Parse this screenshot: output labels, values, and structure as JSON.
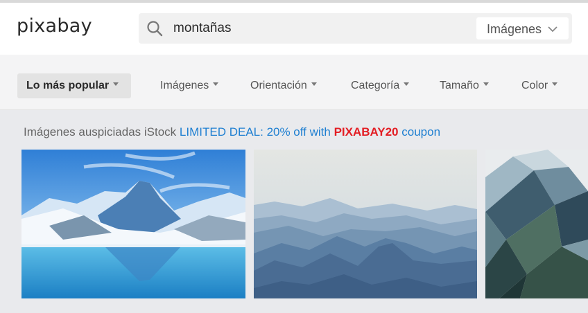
{
  "header": {
    "logo": "pixabay",
    "search": {
      "value": "montañas",
      "placeholder": ""
    },
    "type_select": "Imágenes"
  },
  "filters": {
    "sort": "Lo más popular",
    "items": [
      "Imágenes",
      "Orientación",
      "Categoría",
      "Tamaño",
      "Color"
    ]
  },
  "sponsored": {
    "prefix": "Imágenes auspiciadas iStock",
    "deal_text": "LIMITED DEAL: 20% off with",
    "code": "PIXABAY20",
    "suffix": "coupon"
  },
  "images": [
    {
      "name": "snowy-peak-lake-reflection"
    },
    {
      "name": "misty-blue-mountain-ranges"
    },
    {
      "name": "low-poly-mountains"
    }
  ],
  "colors": {
    "deal_blue": "#1e7fd1",
    "code_red": "#e31e24"
  }
}
